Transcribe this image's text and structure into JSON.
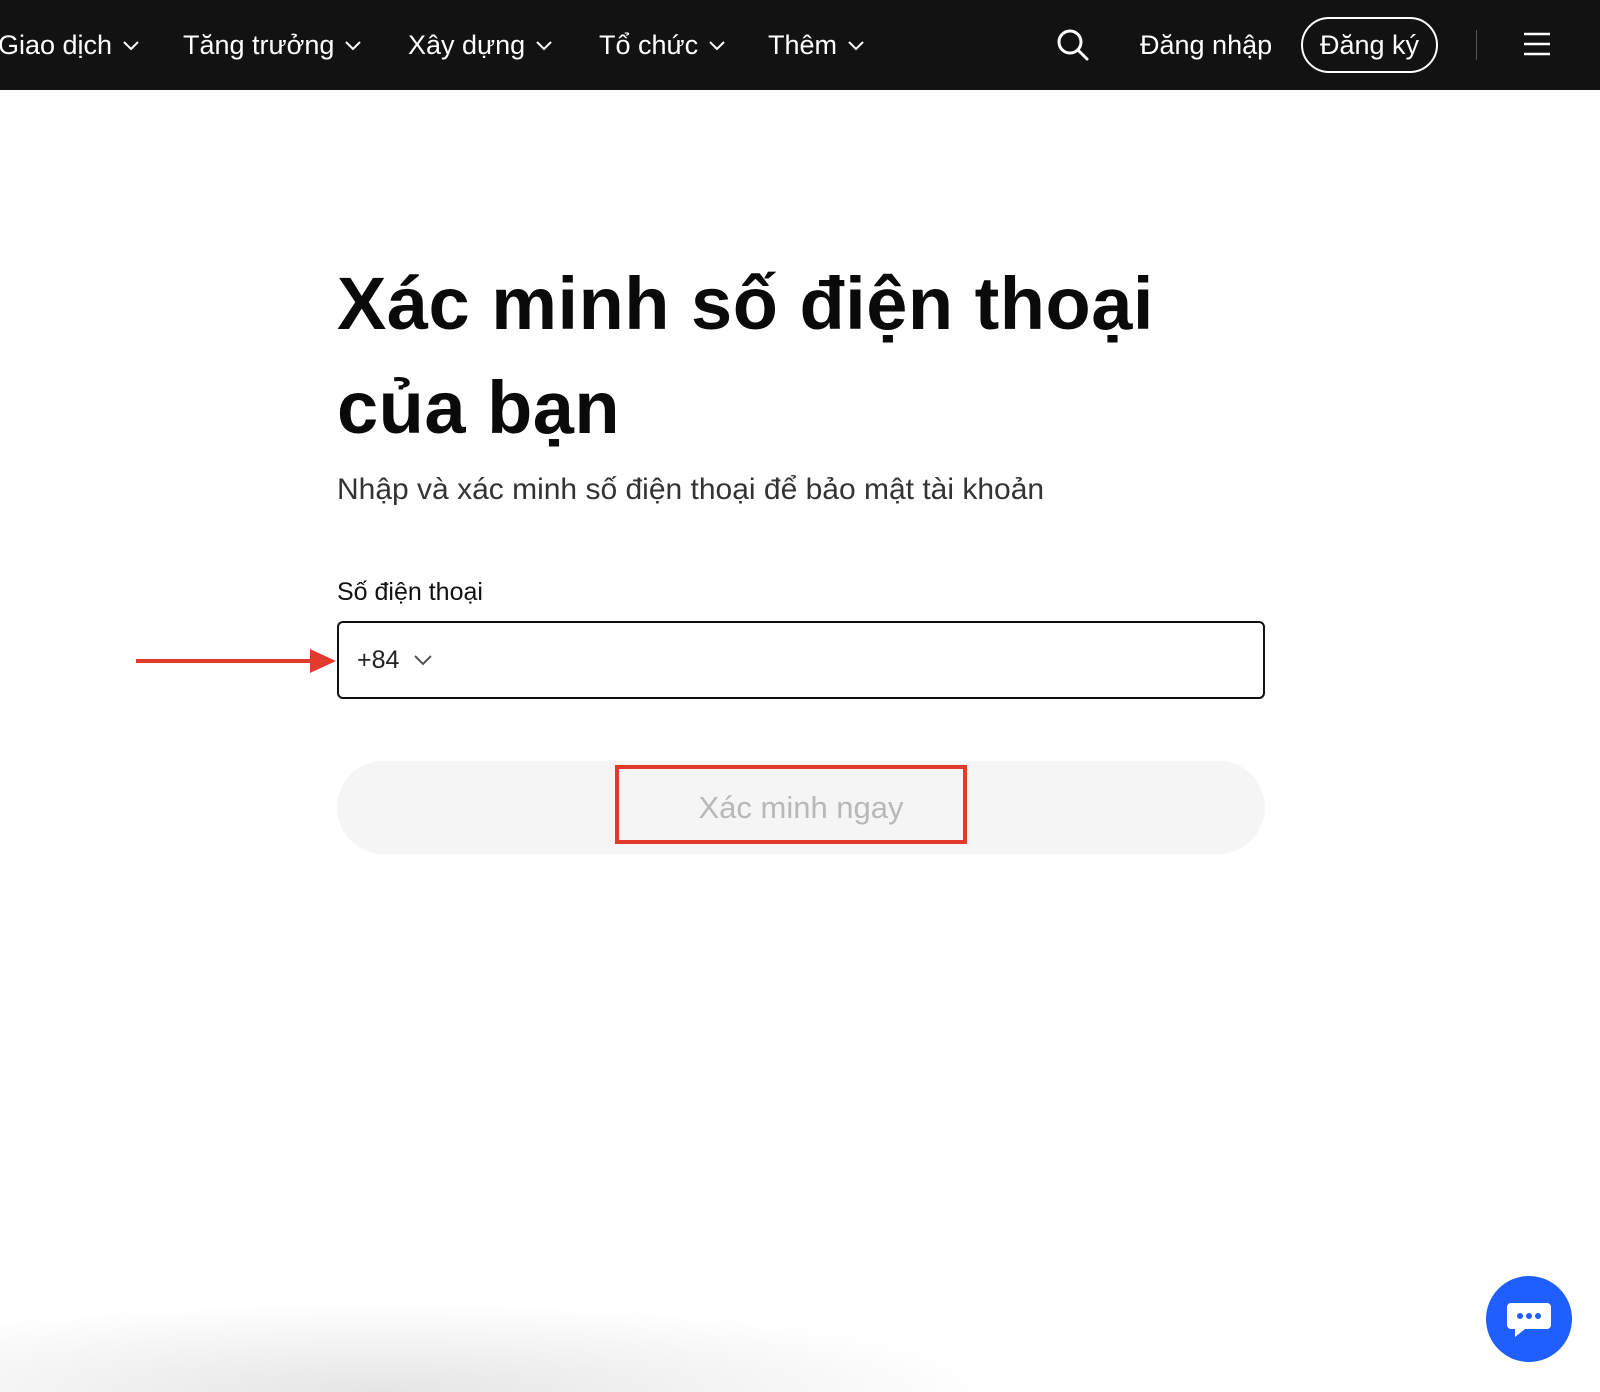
{
  "nav": {
    "items": [
      {
        "label": "Giao dịch",
        "icon": "chevron-down-icon"
      },
      {
        "label": "Tăng trưởng",
        "icon": "chevron-down-icon"
      },
      {
        "label": "Xây dựng",
        "icon": "chevron-down-icon"
      },
      {
        "label": "Tổ chức",
        "icon": "chevron-down-icon"
      },
      {
        "label": "Thêm",
        "icon": "chevron-down-icon"
      }
    ],
    "search_icon": "search-icon",
    "login_label": "Đăng nhập",
    "signup_label": "Đăng ký",
    "menu_icon": "hamburger-menu-icon",
    "background_color": "#121212"
  },
  "main": {
    "title": "Xác minh số điện thoại của bạn",
    "subtitle": "Nhập và xác minh số điện thoại để bảo mật tài khoản",
    "phone_label": "Số điện thoại",
    "country_code": "+84",
    "phone_value": "",
    "verify_label": "Xác minh ngay"
  },
  "annotations": {
    "color": "#e23b2e",
    "arrow": "arrow-right-icon",
    "highlight": "highlight-box"
  },
  "chat": {
    "icon": "chat-bubble-icon",
    "color": "#1f5eff"
  }
}
